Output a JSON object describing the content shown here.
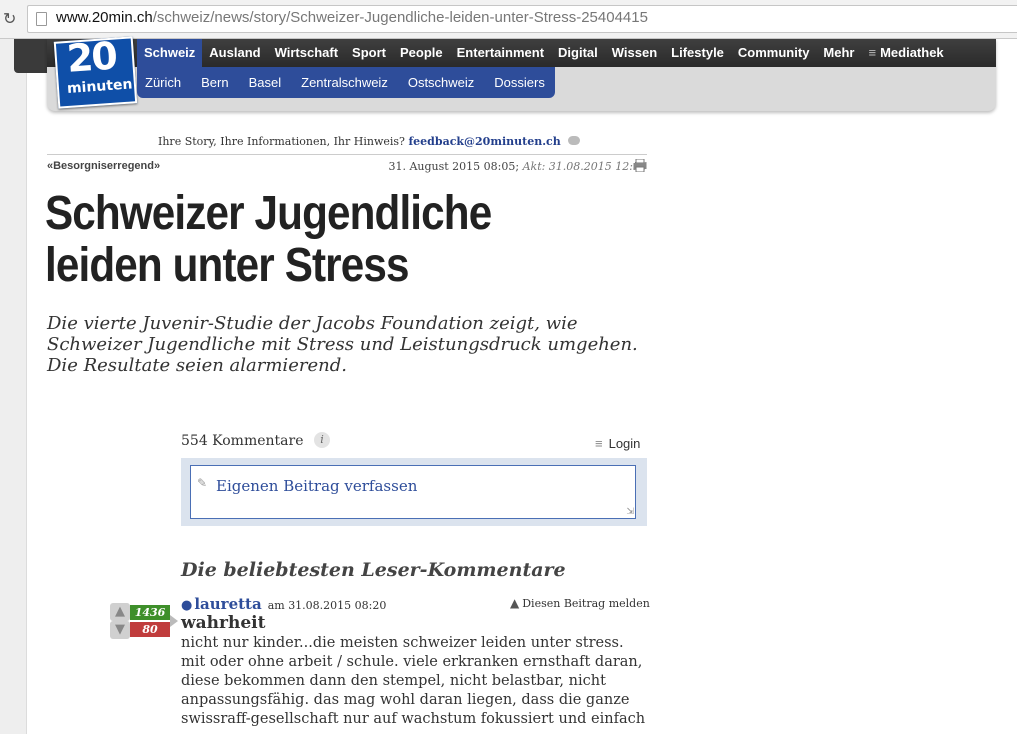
{
  "browser": {
    "url_host": "www.20min.ch",
    "url_path": "/schweiz/news/story/Schweizer-Jugendliche-leiden-unter-Stress-25404415"
  },
  "logo": {
    "number": "20",
    "word": "minuten"
  },
  "nav": {
    "main": [
      "Schweiz",
      "Ausland",
      "Wirtschaft",
      "Sport",
      "People",
      "Entertainment",
      "Digital",
      "Wissen",
      "Lifestyle",
      "Community",
      "Mehr"
    ],
    "mediathek": "Mediathek",
    "sub": [
      "Zürich",
      "Bern",
      "Basel",
      "Zentralschweiz",
      "Ostschweiz",
      "Dossiers"
    ]
  },
  "feedback": {
    "text": "Ihre Story, Ihre Informationen, Ihr Hinweis?",
    "email": "feedback@20minuten.ch"
  },
  "article": {
    "kicker": "«Besorgniserregend»",
    "date": "31. August 2015 08:05;",
    "updated": "Akt: 31.08.2015 12:56",
    "headline": "Schweizer Jugendliche leiden unter Stress",
    "lead": "Die vierte Juvenir-Studie der Jacobs Foundation zeigt, wie Schweizer Jugendliche mit Stress und Leistungsdruck umgehen. Die Resultate seien alarmierend."
  },
  "comments": {
    "count_label": "554 Kommentare",
    "info": "i",
    "login": "Login",
    "compose_placeholder": "Eigenen Beitrag verfassen",
    "top_title": "Die beliebtesten Leser-Kommentare",
    "top": {
      "author": "lauretta",
      "when": "am 31.08.2015 08:20",
      "report": "Diesen Beitrag melden",
      "up": "1436",
      "down": "80",
      "title": "wahrheit",
      "body": "nicht nur kinder...die meisten schweizer leiden unter stress. mit oder ohne arbeit / schule. viele erkranken ernsthaft daran, diese bekommen dann den stempel, nicht belastbar, nicht anpassungsfähig. das mag wohl daran liegen, dass die ganze swissraff-gesellschaft nur auf wachstum fokussiert und einfach"
    }
  },
  "colors": {
    "brand_blue": "#2e4d9a",
    "up_green": "#3e8f2a",
    "down_red": "#c03c3c"
  }
}
